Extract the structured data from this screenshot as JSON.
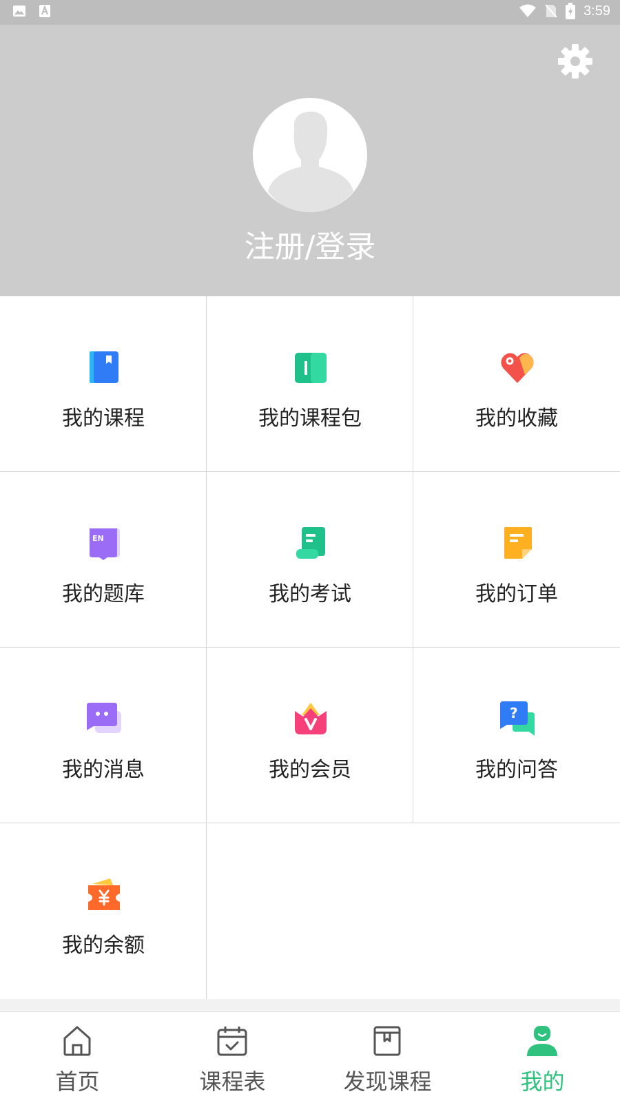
{
  "status_bar": {
    "time": "3:59"
  },
  "profile": {
    "login_text": "注册/登录"
  },
  "menu": {
    "items": [
      {
        "label": "我的课程",
        "icon": "book-icon"
      },
      {
        "label": "我的课程包",
        "icon": "course-package-icon"
      },
      {
        "label": "我的收藏",
        "icon": "heart-tag-icon"
      },
      {
        "label": "我的题库",
        "icon": "question-bank-en-icon"
      },
      {
        "label": "我的考试",
        "icon": "exam-scroll-icon"
      },
      {
        "label": "我的订单",
        "icon": "order-note-icon"
      },
      {
        "label": "我的消息",
        "icon": "message-chat-icon"
      },
      {
        "label": "我的会员",
        "icon": "vip-crown-icon"
      },
      {
        "label": "我的问答",
        "icon": "qa-bubbles-icon"
      },
      {
        "label": "我的余额",
        "icon": "balance-wallet-icon"
      }
    ]
  },
  "bottom_nav": {
    "items": [
      {
        "label": "首页",
        "icon": "home-icon"
      },
      {
        "label": "课程表",
        "icon": "calendar-check-icon"
      },
      {
        "label": "发现课程",
        "icon": "discover-book-icon"
      },
      {
        "label": "我的",
        "icon": "user-icon",
        "active": true
      }
    ]
  },
  "colors": {
    "accent": "#2ec27e",
    "header_bg": "#cccccc",
    "status_bg": "#bdbdbd"
  }
}
